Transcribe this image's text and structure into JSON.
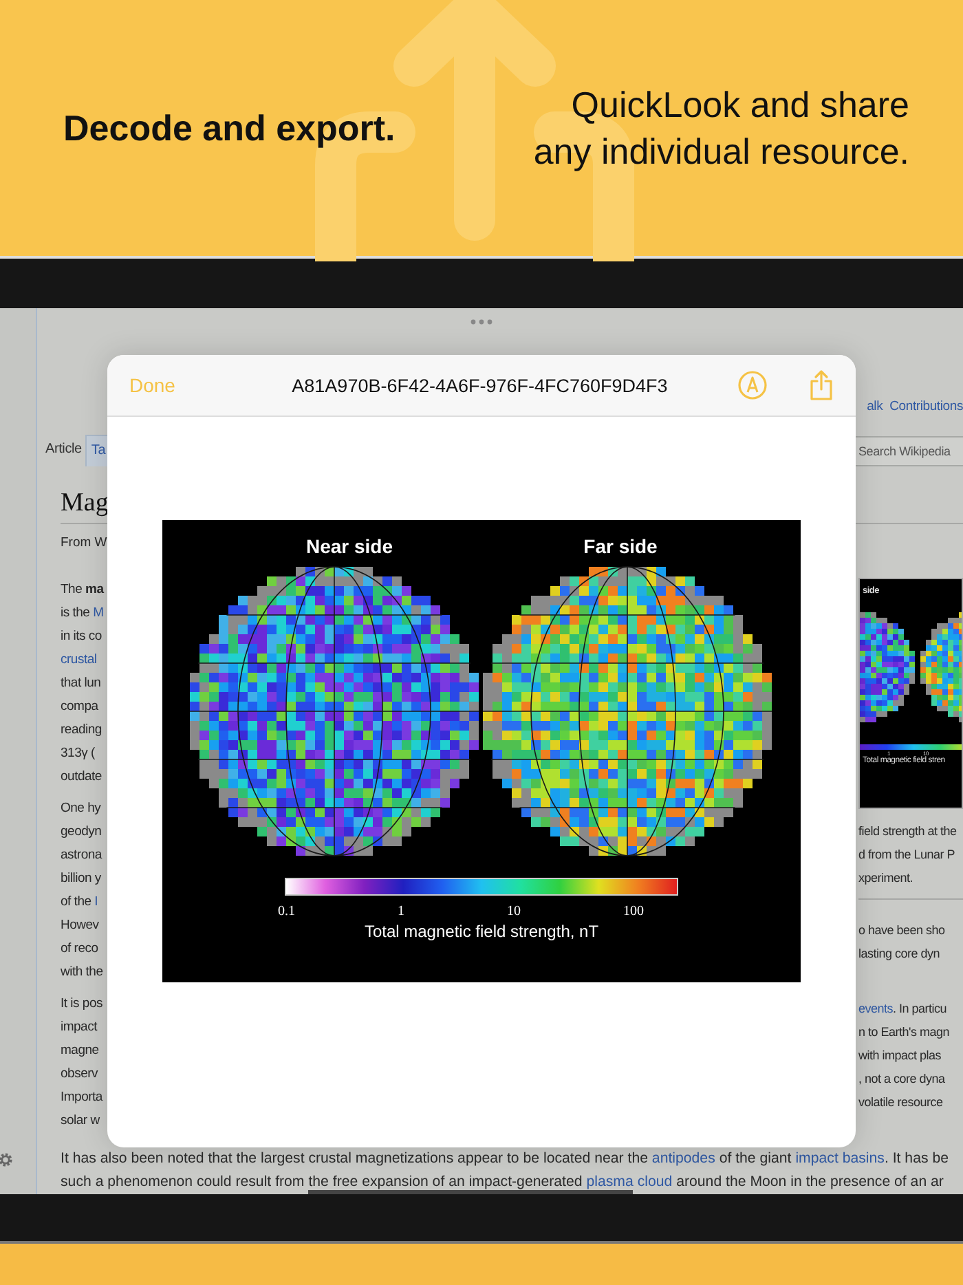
{
  "banner": {
    "headline": "Decode and export.",
    "subhead_lines": [
      "QuickLook and share",
      "any individual resource."
    ]
  },
  "page": {
    "top_links": [
      {
        "text": "alk"
      },
      {
        "text": "Contributions"
      }
    ],
    "tabs": [
      {
        "label": "Article",
        "selected": true
      },
      {
        "label": "Ta",
        "selected": false
      }
    ],
    "search": {
      "placeholder": "Search Wikipedia"
    },
    "heading": "Mag",
    "from": "From W",
    "left_paragraphs": [
      [
        [
          {
            "text": "The ",
            "kind": "plain"
          },
          {
            "text": "ma",
            "kind": "bold"
          }
        ],
        [
          {
            "text": "is the ",
            "kind": "plain"
          },
          {
            "text": "M",
            "kind": "link"
          }
        ],
        [
          {
            "text": "in its co",
            "kind": "plain"
          }
        ],
        [
          {
            "text": "crustal",
            "kind": "link"
          }
        ],
        [
          {
            "text": "that lun",
            "kind": "plain"
          }
        ],
        [
          {
            "text": "compa",
            "kind": "plain"
          }
        ],
        [
          {
            "text": "reading",
            "kind": "plain"
          }
        ],
        [
          {
            "text": "313γ (",
            "kind": "plain"
          }
        ],
        [
          {
            "text": "outdate",
            "kind": "plain"
          }
        ]
      ],
      [
        [
          {
            "text": "One hy",
            "kind": "plain"
          }
        ],
        [
          {
            "text": "geodyn",
            "kind": "plain"
          }
        ],
        [
          {
            "text": "astrona",
            "kind": "plain"
          }
        ],
        [
          {
            "text": "billion y",
            "kind": "plain"
          }
        ],
        [
          {
            "text": "of the ",
            "kind": "plain"
          },
          {
            "text": "I",
            "kind": "link"
          }
        ],
        [
          {
            "text": "Howev",
            "kind": "plain"
          }
        ],
        [
          {
            "text": "of reco",
            "kind": "plain"
          }
        ],
        [
          {
            "text": "with the",
            "kind": "plain"
          }
        ]
      ],
      [
        [
          {
            "text": "It is pos",
            "kind": "plain"
          }
        ],
        [
          {
            "text": "impact",
            "kind": "plain"
          }
        ],
        [
          {
            "text": "magne",
            "kind": "plain"
          }
        ],
        [
          {
            "text": "observ",
            "kind": "plain"
          }
        ],
        [
          {
            "text": "Importa",
            "kind": "plain"
          }
        ],
        [
          {
            "text": "solar w",
            "kind": "plain"
          }
        ]
      ]
    ],
    "thumbnail": {
      "label": "side",
      "ticks": [
        "1",
        "10"
      ],
      "axis_label": "Total magnetic field stren"
    },
    "caption_lines": [
      "field strength at the",
      "d from the Lunar P",
      "xperiment."
    ],
    "right_paragraphs": [
      [
        [
          {
            "text": "o have been sho",
            "kind": "plain"
          }
        ],
        [
          {
            "text": "lasting core dyn",
            "kind": "plain"
          }
        ]
      ],
      [
        [
          {
            "text": "events",
            "kind": "link"
          },
          {
            "text": ". In particu",
            "kind": "plain"
          }
        ],
        [
          {
            "text": "n to Earth's magn",
            "kind": "plain"
          }
        ],
        [
          {
            "text": "with impact plas",
            "kind": "plain"
          }
        ],
        [
          {
            "text": ", not a core dyna",
            "kind": "plain"
          }
        ],
        [
          {
            "text": "volatile resource",
            "kind": "plain"
          }
        ]
      ]
    ],
    "bottom_lines": [
      [
        {
          "text": "It has also been noted that the largest crustal magnetizations appear to be located near the ",
          "kind": "plain"
        },
        {
          "text": "antipodes",
          "kind": "link"
        },
        {
          "text": " of the giant ",
          "kind": "plain"
        },
        {
          "text": "impact basins",
          "kind": "link"
        },
        {
          "text": ". It has be",
          "kind": "plain"
        }
      ],
      [
        {
          "text": "such a phenomenon could result from ",
          "kind": "plain"
        },
        {
          "text": "the free expansion of an impact-generated ",
          "kind": "underlined"
        },
        {
          "text": "plasma",
          "kind": "underlined_link"
        },
        {
          "text": " cloud",
          "kind": "link"
        },
        {
          "text": " around the Moon in the presence of an ar",
          "kind": "plain"
        }
      ]
    ]
  },
  "quicklook": {
    "done": "Done",
    "title": "A81A970B-6F42-4A6F-976F-4FC760F9D4F3",
    "figure": {
      "labels": [
        "Near side",
        "Far side"
      ],
      "ticks": [
        "0.1",
        "1",
        "10",
        "100"
      ],
      "axis_label": "Total magnetic field strength, nT"
    }
  }
}
